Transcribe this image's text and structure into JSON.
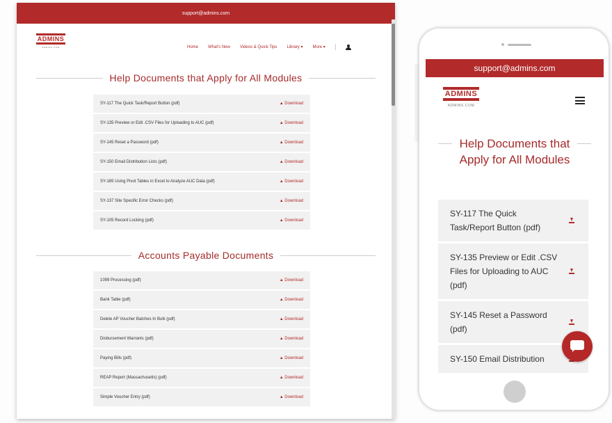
{
  "support_email": "support@admins.com",
  "logo": {
    "name": "ADMINS",
    "sub": "ADMINS.COM"
  },
  "nav": [
    "Home",
    "What's New",
    "Videos & Quick Tips",
    "Library ▾",
    "More ▾"
  ],
  "desktop": {
    "sections": [
      {
        "title": "Help Documents that Apply for All Modules",
        "items": [
          "SY-117 The Quick Task/Report Button (pdf)",
          "SY-135 Preview or Edit .CSV Files for Uploading to AUC (pdf)",
          "SY-145 Reset a Password (pdf)",
          "SY-150 Email Distribution Lists (pdf)",
          "SY-165 Using Pivot Tables in Excel to Analyze AUC Data (pdf)",
          "SY-137 Site Specific Error Checks (pdf)",
          "SY-105 Record Locking (pdf)"
        ]
      },
      {
        "title": "Accounts Payable Documents",
        "items": [
          "1099 Processing (pdf)",
          "Bank Table (pdf)",
          "Delete AP Voucher Batches In Bulk (pdf)",
          "Disbursement Warrants (pdf)",
          "Paying Bills (pdf)",
          "REAP Report (Massachusetts) (pdf)",
          "Simple Voucher Entry (pdf)"
        ]
      }
    ],
    "download_label": "▲ Download"
  },
  "mobile": {
    "title": "Help Documents that Apply for All Modules",
    "items": [
      "SY-117 The Quick Task/Report Button (pdf)",
      "SY-135 Preview or Edit .CSV Files for Uploading to AUC (pdf)",
      "SY-145 Reset a Password (pdf)",
      "SY-150 Email Distribution"
    ]
  },
  "colors": {
    "brand_red": "#b22a2a",
    "item_bg": "#f1f1f1"
  },
  "icons": [
    "user-icon",
    "hamburger-menu-icon",
    "download-icon",
    "chat-icon"
  ]
}
